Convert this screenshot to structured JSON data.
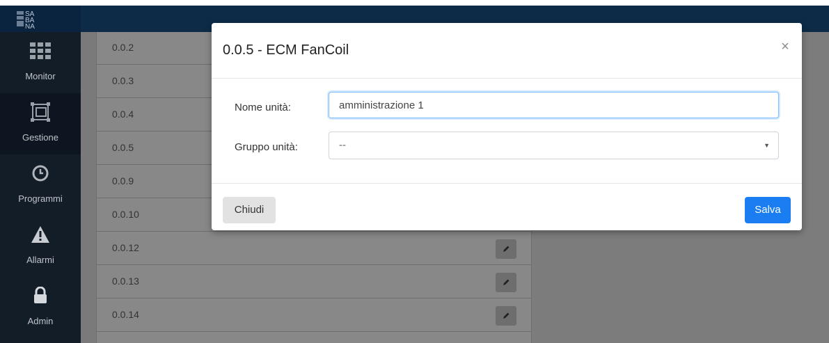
{
  "logo": {
    "text": "SA\nBA\nNA"
  },
  "sidebar": {
    "items": [
      {
        "label": "Monitor",
        "icon": "grid-icon"
      },
      {
        "label": "Gestione",
        "icon": "manage-icon"
      },
      {
        "label": "Programmi",
        "icon": "clock-icon"
      },
      {
        "label": "Allarmi",
        "icon": "warning-icon"
      },
      {
        "label": "Admin",
        "icon": "lock-icon"
      }
    ]
  },
  "list": {
    "rows": [
      "0.0.2",
      "0.0.3",
      "0.0.4",
      "0.0.5",
      "0.0.9",
      "0.0.10",
      "0.0.12",
      "0.0.13",
      "0.0.14"
    ]
  },
  "modal": {
    "title": "0.0.5 - ECM FanCoil",
    "close_symbol": "×",
    "name_label": "Nome unità:",
    "name_value": "amministrazione 1",
    "group_label": "Gruppo unità:",
    "group_value": "--",
    "close_button": "Chiudi",
    "save_button": "Salva"
  },
  "colors": {
    "navbar": "#0d2b47",
    "sidebar": "#131d28",
    "primary": "#1a7ef2"
  }
}
